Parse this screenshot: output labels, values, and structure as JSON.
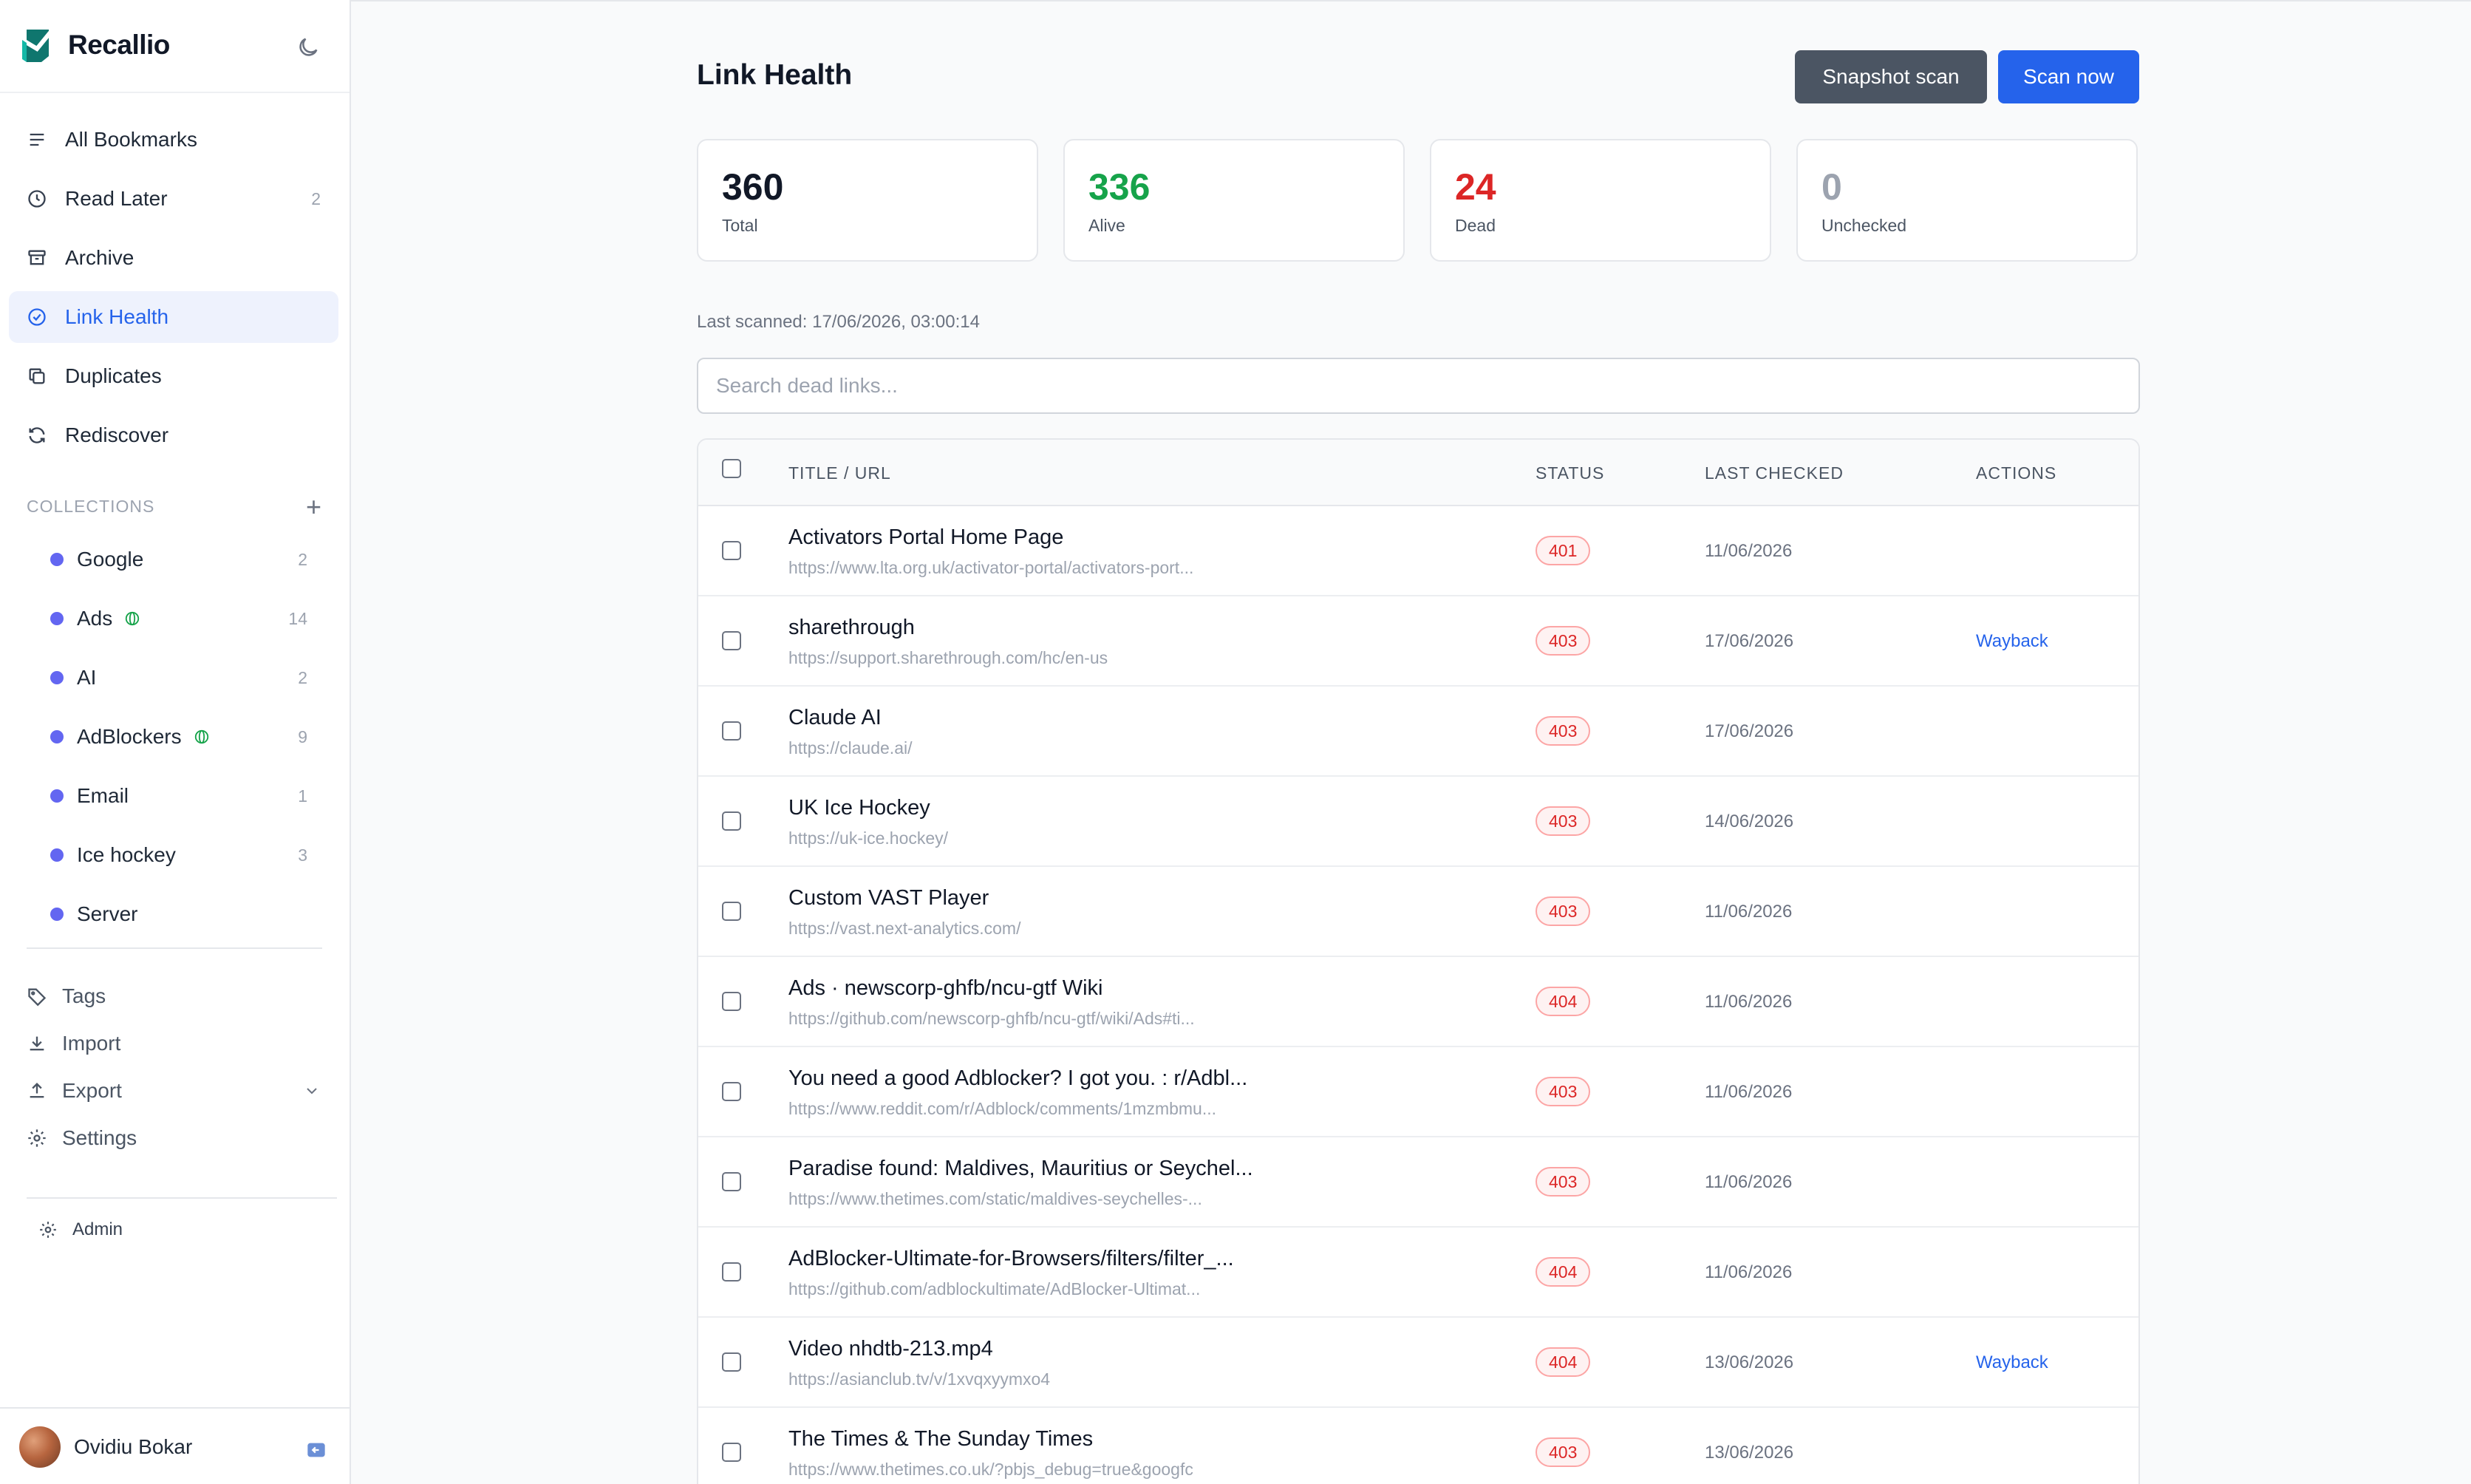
{
  "app": {
    "name": "Recallio"
  },
  "colors": {
    "accent": "#2563eb",
    "alive": "#16a34a",
    "dead": "#dc2626",
    "unchecked": "#9ca3af",
    "collection_dot": "#6366f1"
  },
  "nav": {
    "items": [
      {
        "label": "All Bookmarks",
        "count": "",
        "icon": "list-icon"
      },
      {
        "label": "Read Later",
        "count": "2",
        "icon": "clock-icon"
      },
      {
        "label": "Archive",
        "count": "",
        "icon": "archive-icon"
      },
      {
        "label": "Link Health",
        "count": "",
        "icon": "check-circle-icon",
        "active": true
      },
      {
        "label": "Duplicates",
        "count": "",
        "icon": "copy-icon"
      },
      {
        "label": "Rediscover",
        "count": "",
        "icon": "refresh-icon"
      }
    ]
  },
  "collections": {
    "heading": "COLLECTIONS",
    "add_label": "+",
    "items": [
      {
        "label": "Google",
        "count": "2",
        "shared": false
      },
      {
        "label": "Ads",
        "count": "14",
        "shared": true
      },
      {
        "label": "AI",
        "count": "2",
        "shared": false
      },
      {
        "label": "AdBlockers",
        "count": "9",
        "shared": true
      },
      {
        "label": "Email",
        "count": "1",
        "shared": false
      },
      {
        "label": "Ice hockey",
        "count": "3",
        "shared": false
      },
      {
        "label": "Server",
        "count": "",
        "shared": false
      }
    ]
  },
  "tools": {
    "items": [
      {
        "label": "Tags",
        "icon": "tag-icon"
      },
      {
        "label": "Import",
        "icon": "download-icon"
      },
      {
        "label": "Export",
        "icon": "upload-icon"
      },
      {
        "label": "Settings",
        "icon": "gear-icon"
      }
    ]
  },
  "admin": {
    "label": "Admin"
  },
  "user": {
    "name": "Ovidiu Bokar"
  },
  "page": {
    "title": "Link Health",
    "snapshot_label": "Snapshot scan",
    "scan_label": "Scan now",
    "last_scanned": "Last scanned: 17/06/2026, 03:00:14",
    "search_placeholder": "Search dead links..."
  },
  "stats": {
    "total": {
      "value": "360",
      "label": "Total"
    },
    "alive": {
      "value": "336",
      "label": "Alive"
    },
    "dead": {
      "value": "24",
      "label": "Dead"
    },
    "unchecked": {
      "value": "0",
      "label": "Unchecked"
    }
  },
  "table": {
    "columns": {
      "title": "TITLE / URL",
      "status": "STATUS",
      "checked": "LAST CHECKED",
      "actions": "ACTIONS"
    },
    "rows": [
      {
        "title": "Activators Portal Home Page",
        "url": "https://www.lta.org.uk/activator-portal/activators-port...",
        "status": "401",
        "checked": "11/06/2026",
        "action": ""
      },
      {
        "title": "sharethrough",
        "url": "https://support.sharethrough.com/hc/en-us",
        "status": "403",
        "checked": "17/06/2026",
        "action": "Wayback"
      },
      {
        "title": "Claude AI",
        "url": "https://claude.ai/",
        "status": "403",
        "checked": "17/06/2026",
        "action": ""
      },
      {
        "title": "UK Ice Hockey",
        "url": "https://uk-ice.hockey/",
        "status": "403",
        "checked": "14/06/2026",
        "action": ""
      },
      {
        "title": "Custom VAST Player",
        "url": "https://vast.next-analytics.com/",
        "status": "403",
        "checked": "11/06/2026",
        "action": ""
      },
      {
        "title": "Ads · newscorp-ghfb/ncu-gtf Wiki",
        "url": "https://github.com/newscorp-ghfb/ncu-gtf/wiki/Ads#ti...",
        "status": "404",
        "checked": "11/06/2026",
        "action": ""
      },
      {
        "title": "You need a good Adblocker? I got you. : r/Adbl...",
        "url": "https://www.reddit.com/r/Adblock/comments/1mzmbmu...",
        "status": "403",
        "checked": "11/06/2026",
        "action": ""
      },
      {
        "title": "Paradise found: Maldives, Mauritius or Seychel...",
        "url": "https://www.thetimes.com/static/maldives-seychelles-...",
        "status": "403",
        "checked": "11/06/2026",
        "action": ""
      },
      {
        "title": "AdBlocker-Ultimate-for-Browsers/filters/filter_...",
        "url": "https://github.com/adblockultimate/AdBlocker-Ultimat...",
        "status": "404",
        "checked": "11/06/2026",
        "action": ""
      },
      {
        "title": "Video nhdtb-213.mp4",
        "url": "https://asianclub.tv/v/1xvqxyymxo4",
        "status": "404",
        "checked": "13/06/2026",
        "action": "Wayback"
      },
      {
        "title": "The Times & The Sunday Times",
        "url": "https://www.thetimes.co.uk/?pbjs_debug=true&googfc",
        "status": "403",
        "checked": "13/06/2026",
        "action": ""
      }
    ]
  }
}
